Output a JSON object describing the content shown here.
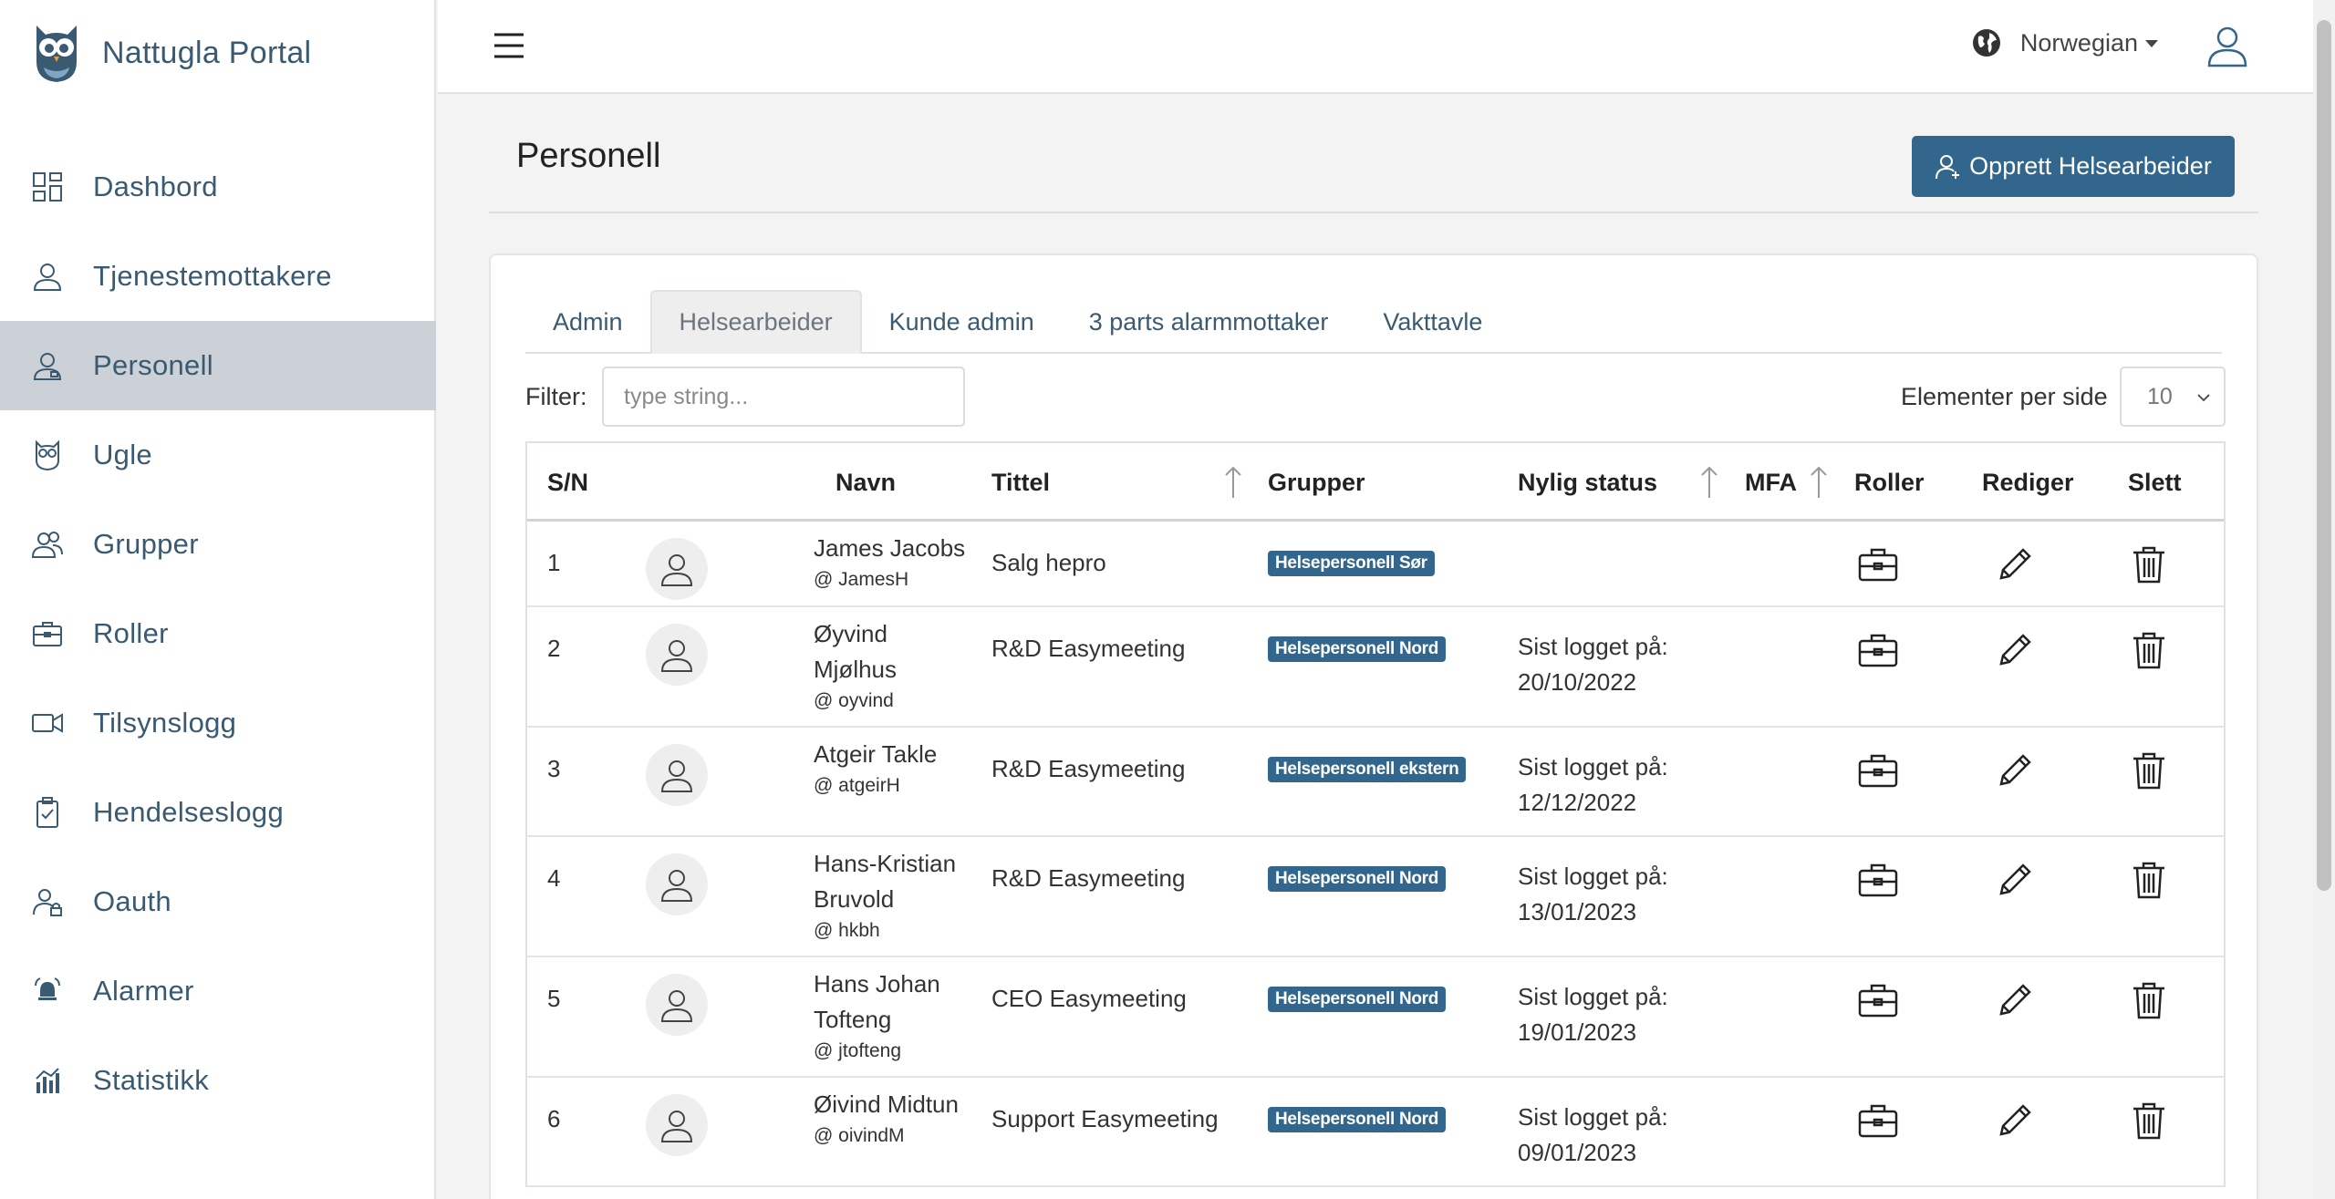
{
  "brand": {
    "name": "Nattugla Portal"
  },
  "sidebar": {
    "items": [
      {
        "label": "Dashbord",
        "icon": "dashboard-icon"
      },
      {
        "label": "Tjenestemottakere",
        "icon": "user-icon"
      },
      {
        "label": "Personell",
        "icon": "user-badge-icon",
        "active": true
      },
      {
        "label": "Ugle",
        "icon": "owl-icon"
      },
      {
        "label": "Grupper",
        "icon": "users-group-icon"
      },
      {
        "label": "Roller",
        "icon": "briefcase-icon"
      },
      {
        "label": "Tilsynslogg",
        "icon": "video-camera-icon"
      },
      {
        "label": "Hendelseslogg",
        "icon": "clipboard-check-icon"
      },
      {
        "label": "Oauth",
        "icon": "user-lock-icon"
      },
      {
        "label": "Alarmer",
        "icon": "alarm-bell-icon"
      },
      {
        "label": "Statistikk",
        "icon": "bar-chart-icon"
      }
    ]
  },
  "topbar": {
    "language": "Norwegian"
  },
  "page": {
    "title": "Personell",
    "create_button": "Opprett Helsearbeider"
  },
  "tabs": [
    {
      "label": "Admin"
    },
    {
      "label": "Helsearbeider",
      "active": true
    },
    {
      "label": "Kunde admin"
    },
    {
      "label": "3 parts alarmmottaker"
    },
    {
      "label": "Vakttavle"
    }
  ],
  "filter": {
    "label": "Filter:",
    "placeholder": "type string...",
    "value": ""
  },
  "per_page": {
    "label": "Elementer per side",
    "value": "10"
  },
  "table": {
    "columns": {
      "sn": "S/N",
      "name": "Navn",
      "title": "Tittel",
      "groups": "Grupper",
      "status": "Nylig status",
      "mfa": "MFA",
      "roles": "Roller",
      "edit": "Rediger",
      "delete": "Slett"
    },
    "rows": [
      {
        "sn": "1",
        "name_line1": "James Jacobs",
        "name_line2": "",
        "username": "@ JamesH",
        "title": "Salg hepro",
        "group": "Helsepersonell Sør",
        "status_line1": "",
        "status_line2": ""
      },
      {
        "sn": "2",
        "name_line1": "Øyvind",
        "name_line2": "Mjølhus",
        "username": "@ oyvind",
        "title": "R&D Easymeeting",
        "group": "Helsepersonell Nord",
        "status_line1": "Sist logget på:",
        "status_line2": "20/10/2022"
      },
      {
        "sn": "3",
        "name_line1": "Atgeir Takle",
        "name_line2": "",
        "username": "@ atgeirH",
        "title": "R&D Easymeeting",
        "group": "Helsepersonell ekstern",
        "status_line1": "Sist logget på:",
        "status_line2": "12/12/2022"
      },
      {
        "sn": "4",
        "name_line1": "Hans-Kristian",
        "name_line2": "Bruvold",
        "username": "@ hkbh",
        "title": "R&D Easymeeting",
        "group": "Helsepersonell Nord",
        "status_line1": "Sist logget på:",
        "status_line2": "13/01/2023"
      },
      {
        "sn": "5",
        "name_line1": "Hans Johan",
        "name_line2": "Tofteng",
        "username": "@ jtofteng",
        "title": "CEO Easymeeting",
        "group": "Helsepersonell Nord",
        "status_line1": "Sist logget på:",
        "status_line2": "19/01/2023"
      },
      {
        "sn": "6",
        "name_line1": "Øivind Midtun",
        "name_line2": "",
        "username": "@ oivindM",
        "title": "Support Easymeeting",
        "group": "Helsepersonell Nord",
        "status_line1": "Sist logget på:",
        "status_line2": "09/01/2023"
      }
    ]
  }
}
